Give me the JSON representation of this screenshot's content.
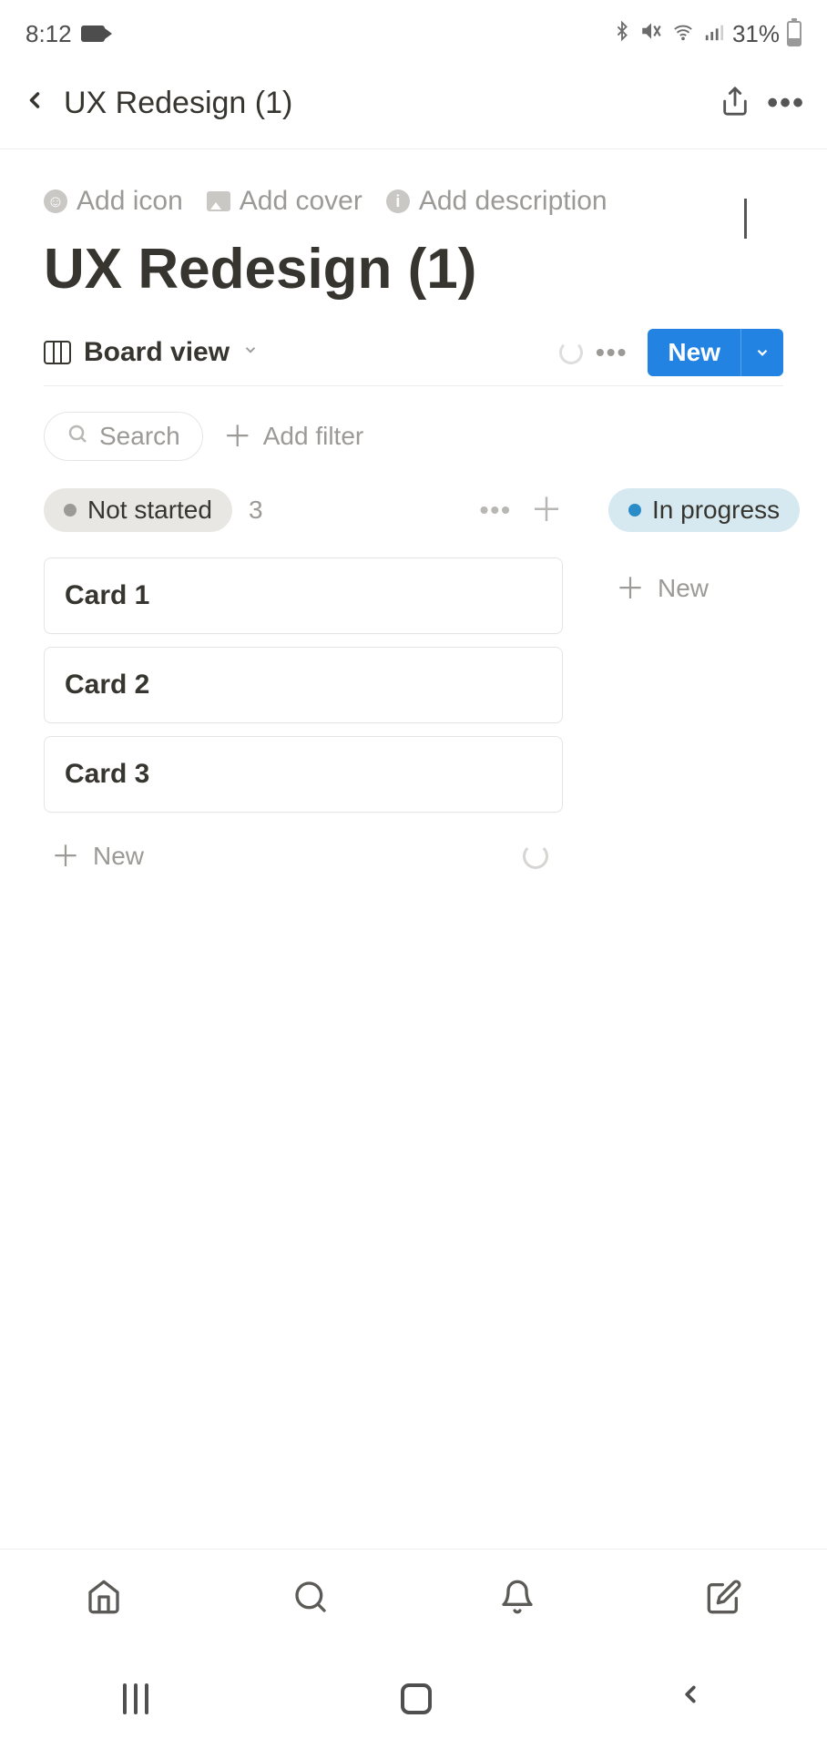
{
  "status_bar": {
    "time": "8:12",
    "battery": "31%"
  },
  "top_nav": {
    "title": "UX Redesign (1)"
  },
  "page_options": {
    "add_icon": "Add icon",
    "add_cover": "Add cover",
    "add_description": "Add description"
  },
  "page": {
    "title": "UX Redesign (1)"
  },
  "view": {
    "name": "Board view",
    "new_label": "New"
  },
  "filters": {
    "search_placeholder": "Search",
    "add_filter": "Add filter"
  },
  "board": {
    "columns": [
      {
        "name": "Not started",
        "count": "3",
        "pill_class": "pill-notstarted",
        "dot_class": "dot-gray",
        "cards": [
          "Card 1",
          "Card 2",
          "Card 3"
        ],
        "new_label": "New",
        "show_actions": true,
        "show_spinner": true
      },
      {
        "name": "In progress",
        "count": "",
        "pill_class": "pill-inprogress",
        "dot_class": "dot-blue",
        "cards": [],
        "new_label": "New",
        "show_actions": false,
        "show_spinner": false
      }
    ]
  }
}
